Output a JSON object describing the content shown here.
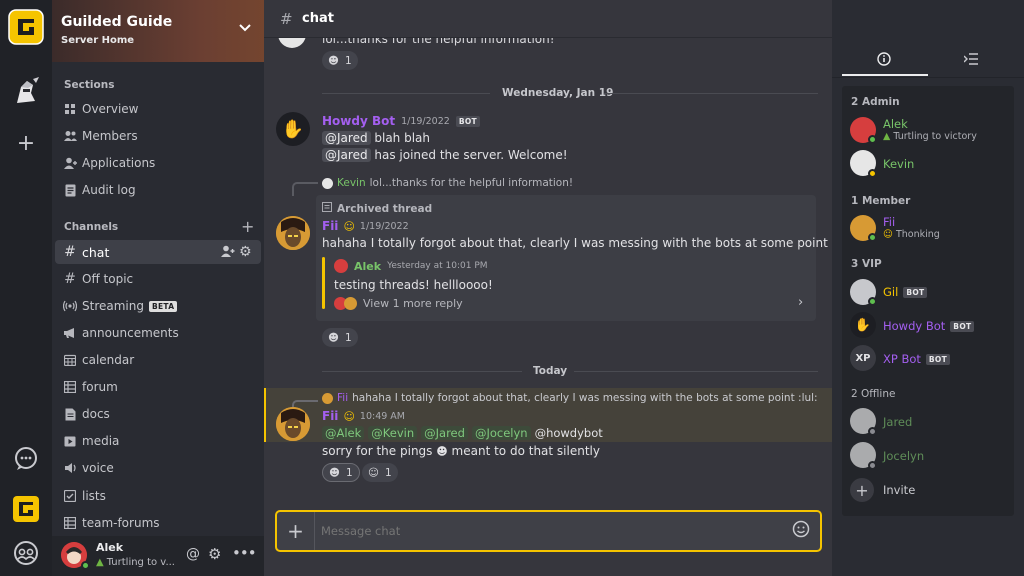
{
  "colors": {
    "accent": "#f5c400",
    "online": "#5fbf4f",
    "bot_name": "#a45ff0",
    "member_green": "#78c469",
    "brand_bg": "#202227"
  },
  "rail": {
    "icons": [
      "guilded-logo-icon",
      "knight-avatar-icon",
      "plus-icon",
      "chat-bubble-icon",
      "guilded-logo-icon",
      "friends-icon"
    ]
  },
  "server": {
    "name": "Guilded Guide",
    "subtitle": "Server Home"
  },
  "sidebar": {
    "sections_title": "Sections",
    "sections": [
      {
        "label": "Overview",
        "icon": "overview-icon"
      },
      {
        "label": "Members",
        "icon": "members-icon"
      },
      {
        "label": "Applications",
        "icon": "applications-icon"
      },
      {
        "label": "Audit log",
        "icon": "audit-log-icon"
      }
    ],
    "channels_title": "Channels",
    "channels": [
      {
        "label": "chat",
        "icon": "hash-icon",
        "active": true
      },
      {
        "label": "Off topic",
        "icon": "hash-icon"
      },
      {
        "label": "Streaming",
        "icon": "stream-icon",
        "badge": "BETA"
      },
      {
        "label": "announcements",
        "icon": "megaphone-icon"
      },
      {
        "label": "calendar",
        "icon": "calendar-icon"
      },
      {
        "label": "forum",
        "icon": "forum-icon"
      },
      {
        "label": "docs",
        "icon": "docs-icon"
      },
      {
        "label": "media",
        "icon": "media-icon"
      },
      {
        "label": "voice",
        "icon": "voice-icon"
      },
      {
        "label": "lists",
        "icon": "lists-icon"
      },
      {
        "label": "team-forums",
        "icon": "forum-icon"
      }
    ]
  },
  "user_bar": {
    "name": "Alek",
    "status": "Turtling to v..."
  },
  "chat": {
    "channel_name": "chat",
    "top_message_text": "lol...thanks for the helpful information!",
    "top_reaction_count": "1",
    "date_divider_1": "Wednesday, Jan 19",
    "msg1": {
      "author": "Howdy Bot",
      "date": "1/19/2022",
      "bot_tag": "BOT",
      "line1_mention": "@Jared",
      "line1_text": " blah blah",
      "line2_mention": "@Jared",
      "line2_text": " has joined the server. Welcome!"
    },
    "reply1": {
      "author": "Kevin",
      "text": "lol...thanks for the helpful information!"
    },
    "thread": {
      "label": "Archived thread",
      "author": "Fii",
      "date": "1/19/2022",
      "text": "hahaha I totally forgot about that, clearly I was messing with the bots at some point",
      "sub_author": "Alek",
      "sub_time": "Yesterday at 10:01 PM",
      "sub_text": "testing threads! hellloooo!",
      "view_replies": "View 1 more reply"
    },
    "thread_reaction_count": "1",
    "date_divider_2": "Today",
    "reply2": {
      "author": "Fii",
      "text": "hahaha I totally forgot about that, clearly I was messing with the bots at some point :lul:"
    },
    "msg3": {
      "author": "Fii",
      "time": "10:49 AM",
      "mentions": [
        "@Alek",
        "@Kevin",
        "@Jared",
        "@Jocelyn"
      ],
      "mention_tail": "@howdybot",
      "text_before": "sorry for the pings",
      "text_after": "meant to do that silently",
      "reaction1_count": "1",
      "reaction2_count": "1"
    },
    "composer_placeholder": "Message chat"
  },
  "members": {
    "groups": [
      {
        "title": "2  Admin"
      },
      {
        "title": "1  Member"
      },
      {
        "title": "3  VIP"
      },
      {
        "title": "2  Offline"
      }
    ],
    "admin": [
      {
        "name": "Alek",
        "status": "Turtling to victory"
      },
      {
        "name": "Kevin"
      }
    ],
    "member": [
      {
        "name": "Fii",
        "status": "Thonking"
      }
    ],
    "vip": [
      {
        "name": "Gil",
        "tag": "BOT"
      },
      {
        "name": "Howdy Bot",
        "tag": "BOT"
      },
      {
        "name": "XP Bot",
        "tag": "BOT"
      }
    ],
    "offline": [
      {
        "name": "Jared"
      },
      {
        "name": "Jocelyn"
      }
    ],
    "invite_label": "Invite"
  }
}
